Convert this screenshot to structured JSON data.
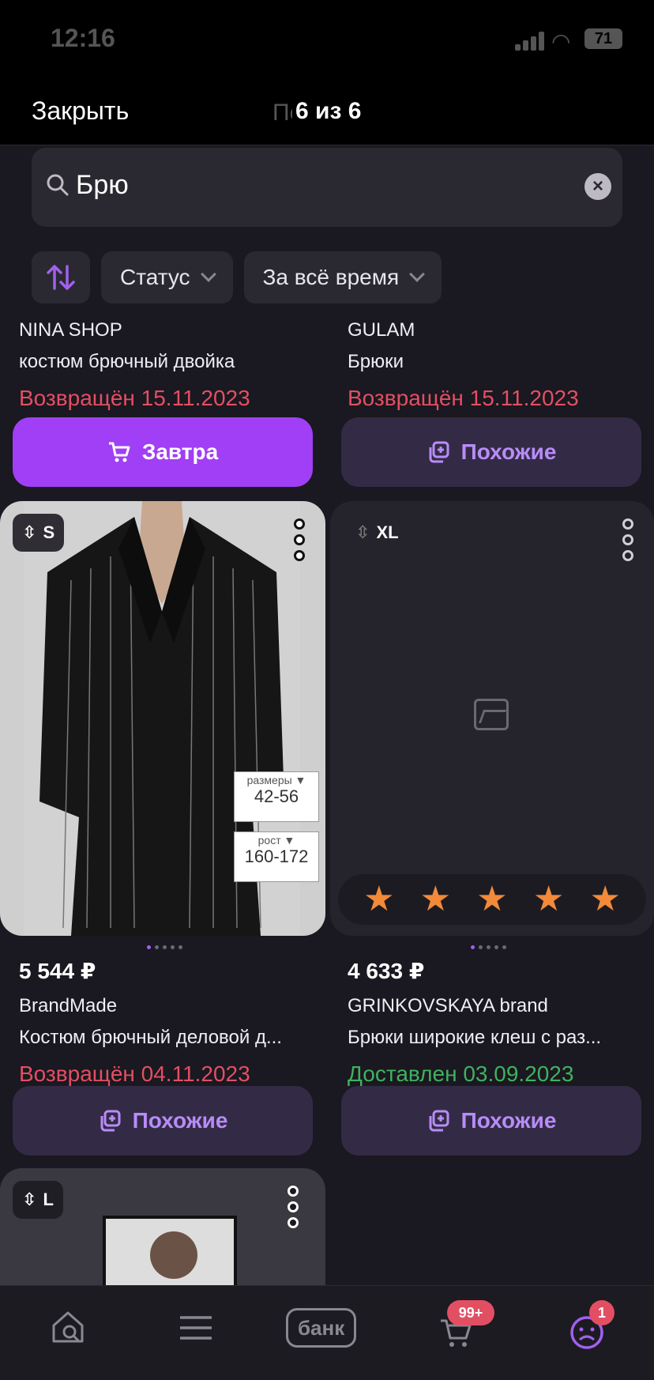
{
  "status_bar": {
    "time": "12:16",
    "battery": "71"
  },
  "nav": {
    "close_label": "Закрыть",
    "counter": "6 из 6",
    "ghost_title": "Покупки"
  },
  "search": {
    "query": "Брю",
    "clear": "×"
  },
  "filters": {
    "status": "Статус",
    "period": "За всё время"
  },
  "row1": [
    {
      "brand": "NINA SHOP",
      "name": "костюм брючный двойка",
      "status": "Возвращён 15.11.2023",
      "button": "Завтра"
    },
    {
      "brand": "GULAM",
      "name": "Брюки",
      "status": "Возвращён 15.11.2023",
      "button": "Похожие"
    }
  ],
  "row2": [
    {
      "size": "S",
      "price": "5 544 ₽",
      "brand": "BrandMade",
      "name": "Костюм брючный деловой д...",
      "status": "Возвращён 04.11.2023",
      "button": "Похожие",
      "tags": {
        "sizes_label": "размеры ▼",
        "sizes_value": "42-56",
        "height_label": "рост ▼",
        "height_value": "160-172"
      }
    },
    {
      "size": "XL",
      "price": "4 633 ₽",
      "brand": "GRINKOVSKAYA brand",
      "name": "Брюки широкие клеш с раз...",
      "status": "Доставлен 03.09.2023",
      "button": "Похожие",
      "rating_stars": 5
    }
  ],
  "row3": [
    {
      "size": "L"
    }
  ],
  "tabbar": {
    "bank_label": "банк",
    "cart_badge": "99+",
    "profile_badge": "1"
  },
  "colors": {
    "accent": "#a03ff5",
    "returned": "#e24f63",
    "delivered": "#3fb25f",
    "star": "#f28a3a"
  }
}
